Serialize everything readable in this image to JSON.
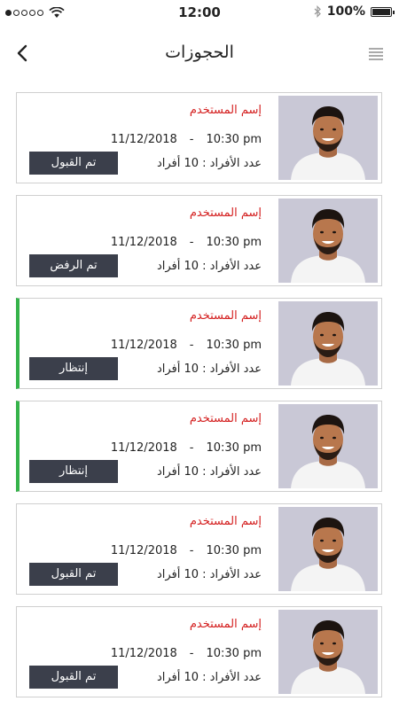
{
  "status_bar": {
    "time": "12:00",
    "battery": "100%",
    "battery_level": 1.0,
    "signal_bars_filled": 1,
    "signal_bars_total": 5
  },
  "header": {
    "title": "الحجوزات"
  },
  "bookings": [
    {
      "user_name": "إسم المستخدم",
      "date": "11/12/2018",
      "separator": "-",
      "time": "10:30 pm",
      "count_text": "عدد الأفراد : 10 أفراد",
      "status": "تم القبول",
      "pending": false
    },
    {
      "user_name": "إسم المستخدم",
      "date": "11/12/2018",
      "separator": "-",
      "time": "10:30 pm",
      "count_text": "عدد الأفراد : 10 أفراد",
      "status": "تم الرفض",
      "pending": false
    },
    {
      "user_name": "إسم المستخدم",
      "date": "11/12/2018",
      "separator": "-",
      "time": "10:30 pm",
      "count_text": "عدد الأفراد : 10 أفراد",
      "status": "إنتظار",
      "pending": true
    },
    {
      "user_name": "إسم المستخدم",
      "date": "11/12/2018",
      "separator": "-",
      "time": "10:30 pm",
      "count_text": "عدد الأفراد : 10 أفراد",
      "status": "إنتظار",
      "pending": true
    },
    {
      "user_name": "إسم المستخدم",
      "date": "11/12/2018",
      "separator": "-",
      "time": "10:30 pm",
      "count_text": "عدد الأفراد : 10 أفراد",
      "status": "تم القبول",
      "pending": false
    },
    {
      "user_name": "إسم المستخدم",
      "date": "11/12/2018",
      "separator": "-",
      "time": "10:30 pm",
      "count_text": "عدد الأفراد : 10 أفراد",
      "status": "تم القبول",
      "pending": false
    }
  ],
  "colors": {
    "user_name": "#d42020",
    "status_button": "#3b3f4b",
    "pending_accent": "#35b34a",
    "card_border": "#cfcfcf"
  },
  "icons": {
    "back": "chevron-left-icon",
    "menu": "hamburger-menu-icon",
    "wifi": "wifi-icon",
    "bluetooth": "bluetooth-icon",
    "battery": "battery-icon"
  }
}
